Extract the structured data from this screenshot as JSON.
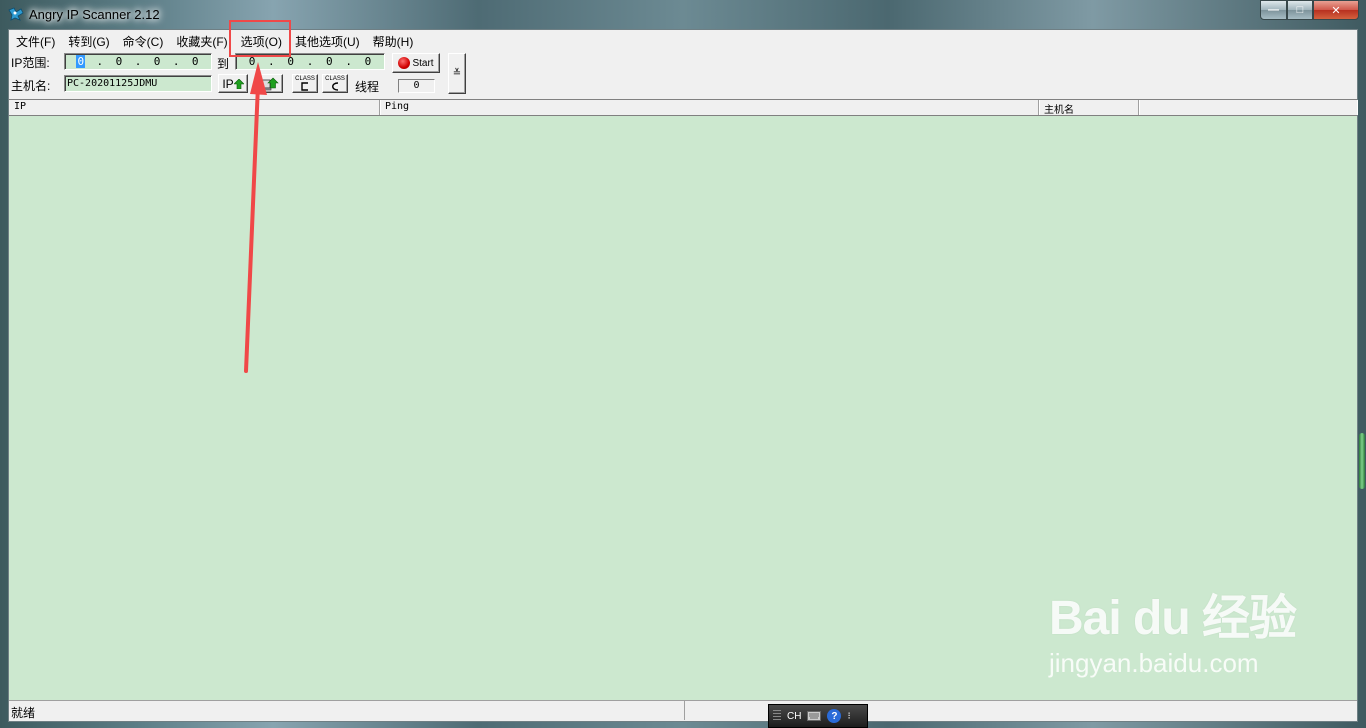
{
  "window": {
    "title": "Angry IP Scanner 2.12",
    "min_label": "—",
    "max_label": "□",
    "close_label": "✕"
  },
  "menu": [
    {
      "label": "文件(F)"
    },
    {
      "label": "转到(G)"
    },
    {
      "label": "命令(C)"
    },
    {
      "label": "收藏夹(F)"
    },
    {
      "label": "选项(O)"
    },
    {
      "label": "其他选项(U)"
    },
    {
      "label": "帮助(H)"
    }
  ],
  "toolbar": {
    "ip_range_label": "IP范围:",
    "from": [
      "0",
      "0",
      "0",
      "0"
    ],
    "to_label": "到",
    "to": [
      "0",
      "0",
      "0",
      "0"
    ],
    "start_label": "Start",
    "host_label": "主机名:",
    "host_value": "PC-20201125JDMU",
    "ip_up_label": "IP",
    "class_label": "CLASS",
    "threads_label": "线程",
    "threads_value": "0",
    "expand_label": "≚"
  },
  "table": {
    "columns": [
      "IP",
      "Ping",
      "主机名"
    ]
  },
  "statusbar": {
    "status": "就绪"
  },
  "langbar": {
    "lang": "CH",
    "help": "?"
  },
  "watermark": {
    "logo": "Bai du 经验",
    "url": "jingyan.baidu.com"
  },
  "colors": {
    "list_bg": "#cce8cf",
    "annotation": "#f04848"
  }
}
